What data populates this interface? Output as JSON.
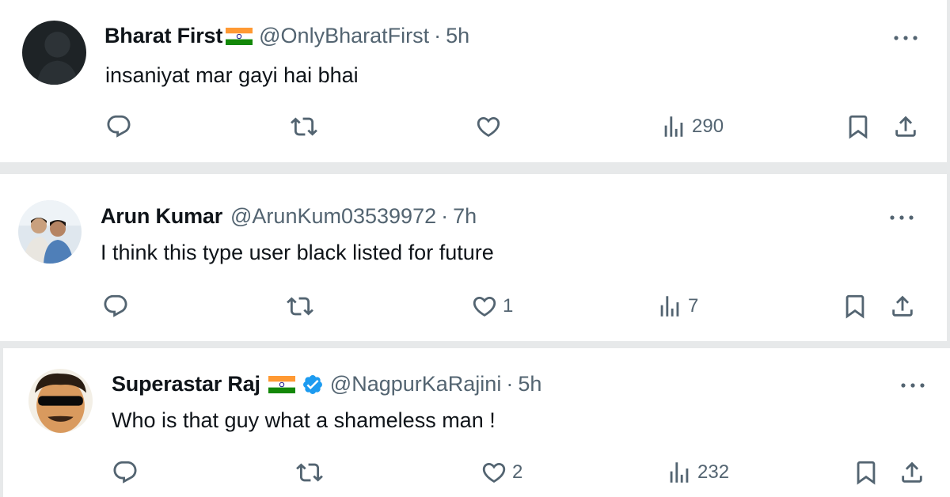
{
  "tweets": [
    {
      "name": "Bharat First",
      "handle": "@OnlyBharatFirst",
      "separator": "·",
      "time": "5h",
      "text": "insaniyat mar gayi hai bhai",
      "likes": "",
      "views": "290"
    },
    {
      "name": "Arun Kumar",
      "handle": "@ArunKum03539972",
      "separator": "·",
      "time": "7h",
      "text": "I think this type user black listed for future",
      "likes": "1",
      "views": "7"
    },
    {
      "name": "Superastar Raj",
      "handle": "@NagpurKaRajini",
      "separator": "·",
      "time": "5h",
      "text": "Who is that guy what a shameless man !",
      "likes": "2",
      "views": "232"
    }
  ],
  "icons": {
    "reply": "reply-icon",
    "retweet": "retweet-icon",
    "like": "like-icon",
    "views": "views-icon",
    "bookmark": "bookmark-icon",
    "share": "share-icon",
    "more": "more-icon",
    "flag": "india-flag-icon",
    "verified": "verified-badge-icon"
  },
  "colors": {
    "text": "#0f1419",
    "secondary": "#536471",
    "verified": "#1d9bf0",
    "divider": "#e7e9ea"
  }
}
